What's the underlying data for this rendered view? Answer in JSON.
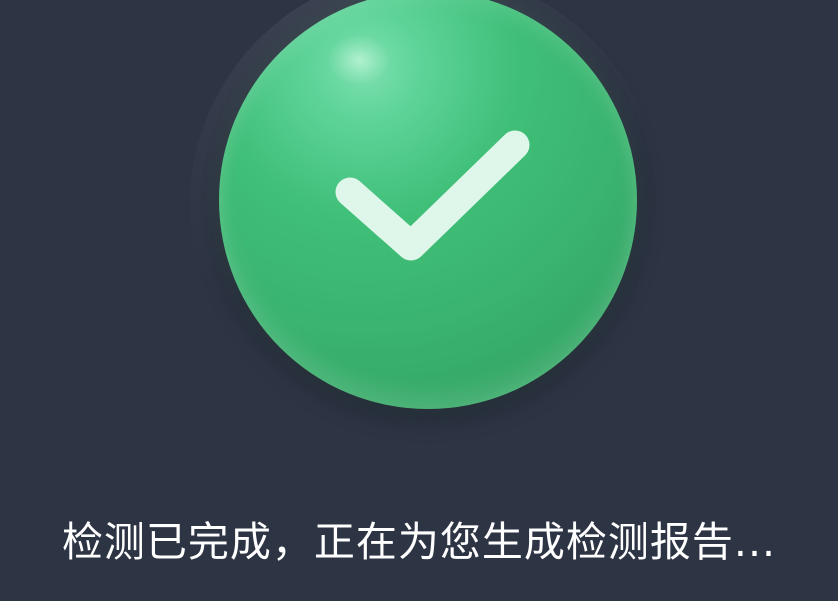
{
  "screen": {
    "background_color": "#2d3444"
  },
  "status_icon": {
    "name": "check-circle-icon",
    "color": "#3fbf78",
    "check_color": "#dff6ea"
  },
  "status": {
    "message": "检测已完成，正在为您生成检测报告..."
  }
}
